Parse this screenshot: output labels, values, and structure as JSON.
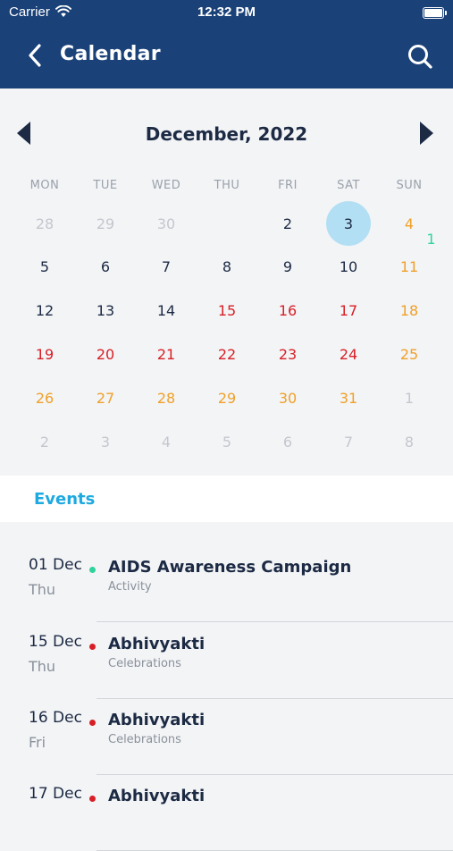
{
  "status_bar": {
    "carrier": "Carrier",
    "time": "12:32 PM"
  },
  "header": {
    "title": "Calendar",
    "back_icon": "chevron-left-icon",
    "search_icon": "search-icon"
  },
  "calendar": {
    "month_label": "December, 2022",
    "weekdays": [
      "MON",
      "TUE",
      "WED",
      "THU",
      "FRI",
      "SAT",
      "SUN"
    ],
    "selected_day": "3",
    "weeks": [
      [
        {
          "d": "28",
          "s": "muted"
        },
        {
          "d": "29",
          "s": "muted"
        },
        {
          "d": "30",
          "s": "muted"
        },
        {
          "d": "1",
          "s": "event"
        },
        {
          "d": "2",
          "s": "normal"
        },
        {
          "d": "3",
          "s": "selected"
        },
        {
          "d": "4",
          "s": "weekend"
        }
      ],
      [
        {
          "d": "5",
          "s": "normal"
        },
        {
          "d": "6",
          "s": "normal"
        },
        {
          "d": "7",
          "s": "normal"
        },
        {
          "d": "8",
          "s": "normal"
        },
        {
          "d": "9",
          "s": "normal"
        },
        {
          "d": "10",
          "s": "normal"
        },
        {
          "d": "11",
          "s": "weekend"
        }
      ],
      [
        {
          "d": "12",
          "s": "normal"
        },
        {
          "d": "13",
          "s": "normal"
        },
        {
          "d": "14",
          "s": "normal"
        },
        {
          "d": "15",
          "s": "holiday"
        },
        {
          "d": "16",
          "s": "holiday"
        },
        {
          "d": "17",
          "s": "holiday"
        },
        {
          "d": "18",
          "s": "weekend"
        }
      ],
      [
        {
          "d": "19",
          "s": "holiday"
        },
        {
          "d": "20",
          "s": "holiday"
        },
        {
          "d": "21",
          "s": "holiday"
        },
        {
          "d": "22",
          "s": "holiday"
        },
        {
          "d": "23",
          "s": "holiday"
        },
        {
          "d": "24",
          "s": "holiday"
        },
        {
          "d": "25",
          "s": "weekend"
        }
      ],
      [
        {
          "d": "26",
          "s": "weekend"
        },
        {
          "d": "27",
          "s": "weekend"
        },
        {
          "d": "28",
          "s": "weekend"
        },
        {
          "d": "29",
          "s": "weekend"
        },
        {
          "d": "30",
          "s": "weekend"
        },
        {
          "d": "31",
          "s": "weekend"
        },
        {
          "d": "1",
          "s": "muted"
        }
      ],
      [
        {
          "d": "2",
          "s": "muted"
        },
        {
          "d": "3",
          "s": "muted"
        },
        {
          "d": "4",
          "s": "muted"
        },
        {
          "d": "5",
          "s": "muted"
        },
        {
          "d": "6",
          "s": "muted"
        },
        {
          "d": "7",
          "s": "muted"
        },
        {
          "d": "8",
          "s": "muted"
        }
      ]
    ]
  },
  "events_section": {
    "label": "Events",
    "items": [
      {
        "date": "01 Dec",
        "weekday": "Thu",
        "title": "AIDS Awareness Campaign",
        "category": "Activity",
        "dot_color": "#2fd39b"
      },
      {
        "date": "15 Dec",
        "weekday": "Thu",
        "title": "Abhivyakti",
        "category": "Celebrations",
        "dot_color": "#d81f26"
      },
      {
        "date": "16 Dec",
        "weekday": "Fri",
        "title": "Abhivyakti",
        "category": "Celebrations",
        "dot_color": "#d81f26"
      },
      {
        "date": "17 Dec",
        "weekday": "",
        "title": "Abhivyakti",
        "category": "",
        "dot_color": "#d81f26"
      }
    ]
  },
  "colors": {
    "header_bg": "#1a4178",
    "accent": "#1ea9e1",
    "holiday": "#d81f26",
    "weekend": "#f0a028",
    "event": "#2fd39b",
    "selected_bg": "#b3dff4"
  }
}
